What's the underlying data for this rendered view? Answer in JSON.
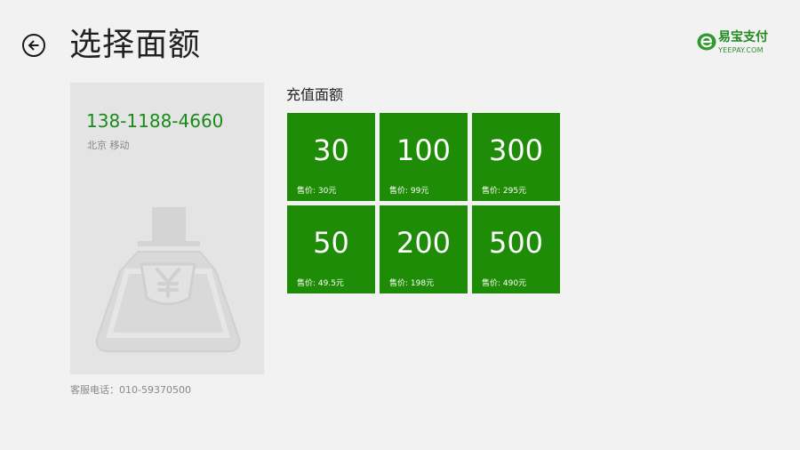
{
  "header": {
    "title": "选择面额",
    "back_icon": "arrow-left-icon"
  },
  "brand": {
    "name": "易宝支付",
    "domain": "YEEPAY.COM",
    "color": "#1f8a1f"
  },
  "account": {
    "phone": "138-1188-4660",
    "carrier": "北京 移动",
    "illustration_icon": "money-bag-icon"
  },
  "footer": {
    "hotline": "客服电话：010-59370500"
  },
  "recharge": {
    "section_title": "充值面额",
    "tile_color": "#1e8c06",
    "options": [
      {
        "amount": "30",
        "price": "售价: 30元"
      },
      {
        "amount": "100",
        "price": "售价: 99元"
      },
      {
        "amount": "300",
        "price": "售价: 295元"
      },
      {
        "amount": "50",
        "price": "售价: 49.5元"
      },
      {
        "amount": "200",
        "price": "售价: 198元"
      },
      {
        "amount": "500",
        "price": "售价: 490元"
      }
    ]
  }
}
